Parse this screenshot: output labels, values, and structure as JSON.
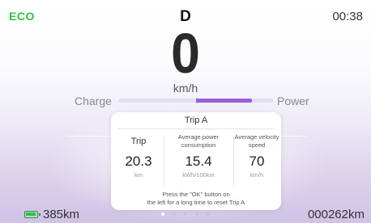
{
  "status_bar": {
    "mode": "ECO",
    "gear": "D",
    "time": "00:38"
  },
  "speedometer": {
    "speed": "0",
    "unit": "km/h"
  },
  "power_bar": {
    "left_label": "Charge",
    "right_label": "Power",
    "power_level": 0.72
  },
  "trip_card": {
    "title": "Trip A",
    "columns": [
      {
        "header": "Trip",
        "value": "20.3",
        "unit": "km"
      },
      {
        "header": "Average power consumption",
        "value": "15.4",
        "unit": "kWh/100km"
      },
      {
        "header": "Average velocity speed",
        "value": "70",
        "unit": "km/h"
      }
    ],
    "note_line1": "Press the \"OK\" button on",
    "note_line2": "the left for a long time to reset Trip A"
  },
  "pager": {
    "count": 5,
    "active_index": 0
  },
  "bottom_bar": {
    "range": "385km",
    "odometer": "000262km"
  },
  "colors": {
    "eco_green": "#2bc43c",
    "power_purple": "#9b5fd6",
    "track": "#e2e0f0"
  },
  "icons": {
    "battery": "battery-icon"
  }
}
